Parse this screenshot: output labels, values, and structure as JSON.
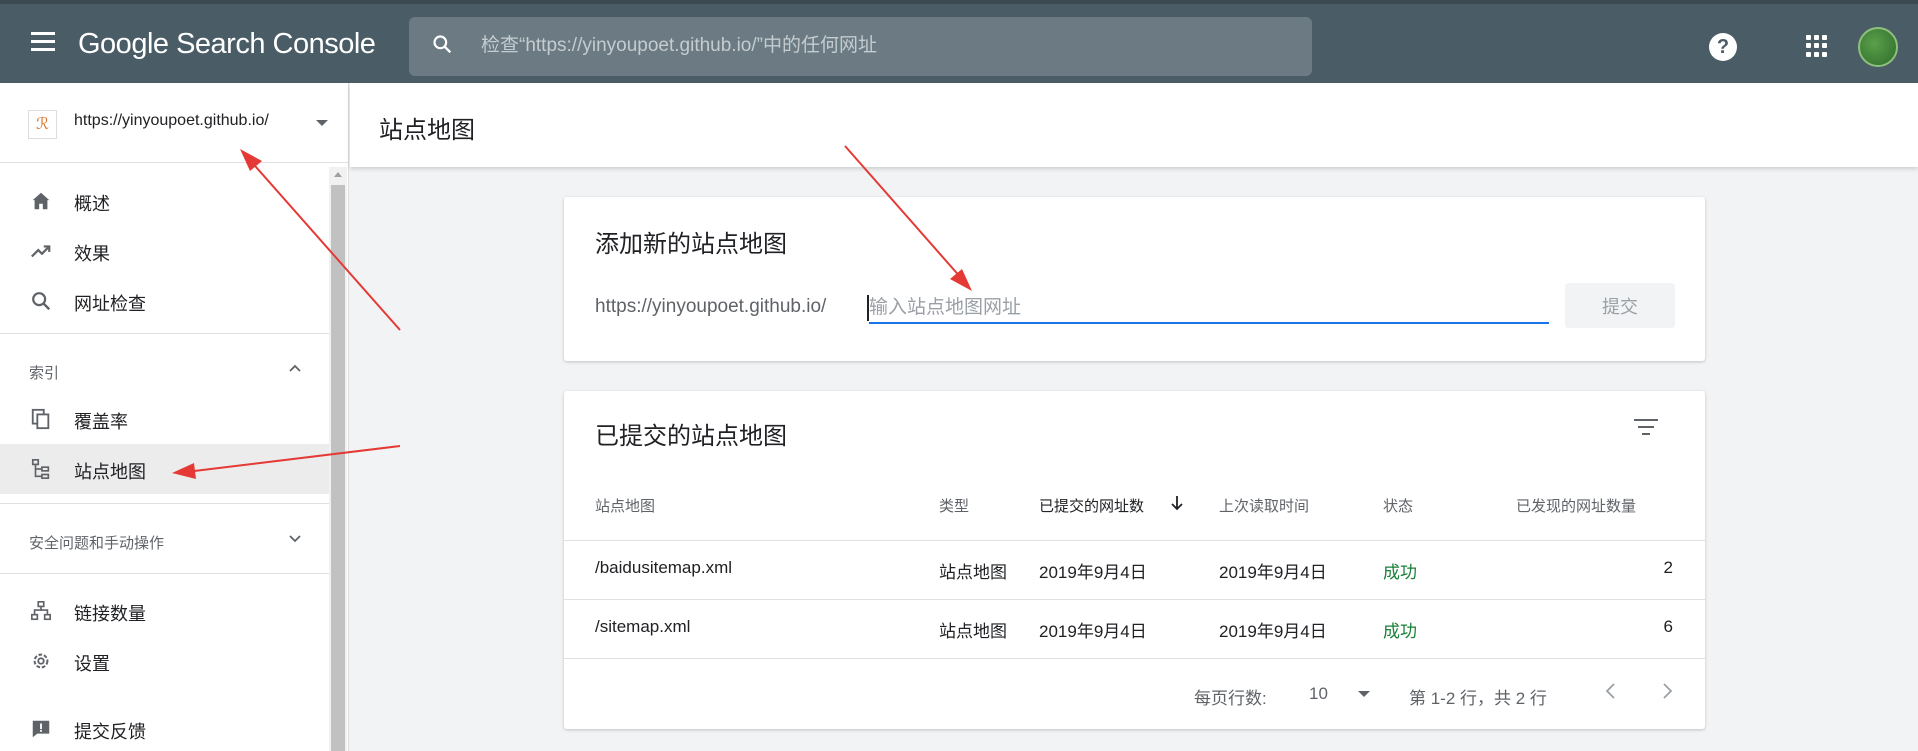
{
  "topbar": {
    "app_title": "Google Search Console",
    "search_placeholder": "检查“https://yinyoupoet.github.io/”中的任何网址",
    "help_label": "?"
  },
  "sidebar": {
    "property_url": "https://yinyoupoet.github.io/",
    "property_logo": "ℛ",
    "items_top": [
      {
        "label": "概述",
        "icon": "home-icon"
      },
      {
        "label": "效果",
        "icon": "trending-up-icon"
      },
      {
        "label": "网址检查",
        "icon": "search-icon"
      }
    ],
    "section_index": {
      "label": "索引",
      "expanded": true
    },
    "items_index": [
      {
        "label": "覆盖率",
        "icon": "copy-icon"
      },
      {
        "label": "站点地图",
        "icon": "sitemap-icon",
        "active": true
      }
    ],
    "section_security": {
      "label": "安全问题和手动操作",
      "expanded": false
    },
    "items_bottom": [
      {
        "label": "链接数量",
        "icon": "links-icon"
      },
      {
        "label": "设置",
        "icon": "gear-icon"
      },
      {
        "label": "提交反馈",
        "icon": "feedback-icon"
      }
    ]
  },
  "main": {
    "page_title": "站点地图",
    "add_card": {
      "title": "添加新的站点地图",
      "prefix": "https://yinyoupoet.github.io/",
      "input_placeholder": "输入站点地图网址",
      "submit_label": "提交"
    },
    "submitted_card": {
      "title": "已提交的站点地图",
      "columns": [
        "站点地图",
        "类型",
        "已提交的网址数",
        "上次读取时间",
        "状态",
        "已发现的网址数量"
      ],
      "sorted_column": "已提交的网址数",
      "rows": [
        {
          "sitemap": "/baidusitemap.xml",
          "type": "站点地图",
          "submitted": "2019年9月4日",
          "last_read": "2019年9月4日",
          "status": "成功",
          "discovered": "2"
        },
        {
          "sitemap": "/sitemap.xml",
          "type": "站点地图",
          "submitted": "2019年9月4日",
          "last_read": "2019年9月4日",
          "status": "成功",
          "discovered": "6"
        }
      ],
      "pager": {
        "rows_per_page_label": "每页行数:",
        "rows_per_page": "10",
        "range": "第 1-2 行，共 2 行"
      }
    }
  },
  "colors": {
    "topbar": "#4a5c66",
    "accent_blue": "#1a73e8",
    "status_success": "#188038",
    "annotation_arrow": "#e53935"
  }
}
